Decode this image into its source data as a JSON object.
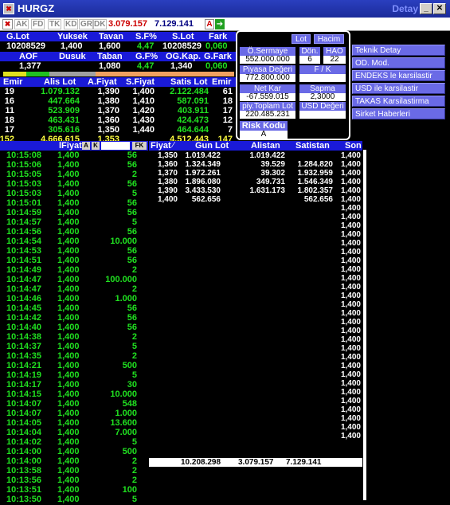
{
  "window": {
    "symbol": "HURGZ",
    "detail_label": "Detay"
  },
  "toolbar": {
    "buttons": [
      "AK",
      "FD",
      "TK",
      "KD",
      "GR",
      "DK"
    ],
    "price_value": "3.079.157",
    "volume_value": "7.129.141",
    "a_label": "A"
  },
  "summary": {
    "headers1": [
      "G.Lot",
      "Yuksek",
      "Tavan",
      "S.F%",
      "S.Lot",
      "Fark"
    ],
    "values1": [
      "10208529",
      "1,400",
      "1,600",
      "4,47",
      "10208529",
      "0,060"
    ],
    "headers2": [
      "AOF",
      "Dusuk",
      "Taban",
      "G.F%",
      "OG.Kap.",
      "G.Fark"
    ],
    "values2": [
      "1,377",
      "",
      "1,080",
      "4,47",
      "1,340",
      "0,060"
    ]
  },
  "depth": {
    "headers": [
      "Emir",
      "Alis Lot",
      "A.Fiyat",
      "S.Fiyat",
      "Satis Lot",
      "Emir"
    ],
    "rows": [
      [
        "19",
        "1.079.132",
        "1,390",
        "1,400",
        "2.122.484",
        "61"
      ],
      [
        "16",
        "447.664",
        "1,380",
        "1,410",
        "587.091",
        "18"
      ],
      [
        "11",
        "523.909",
        "1,370",
        "1,420",
        "403.911",
        "17"
      ],
      [
        "18",
        "463.431",
        "1,360",
        "1,430",
        "424.473",
        "12"
      ],
      [
        "17",
        "305.616",
        "1,350",
        "1,440",
        "464.644",
        "7"
      ]
    ],
    "totals": [
      "152",
      "4.666.615",
      "1,353",
      "",
      "4.512.443",
      "147"
    ]
  },
  "popup": {
    "lot_btn": "Lot",
    "hacim_btn": "Hacim",
    "osermaye_label": "Ö.Sermaye",
    "osermaye_value": "552.000.000",
    "don_label": "Dön.",
    "don_value": "6",
    "hao_label": "HAO",
    "hao_value": "22",
    "piyasa_label": "Piyasa Değeri",
    "piyasa_value": "772.800.000",
    "fk_label": "F / K",
    "fk_value": "",
    "netkar_label": "Net Kar",
    "netkar_value": "-67.559.015",
    "sapma_label": "Sapma",
    "sapma_value": "2,3000",
    "piytop_label": "piy.Toplam Lot",
    "piytop_value": "220.485.231",
    "usd_label": "USD Değeri",
    "usd_value": "",
    "risk_label": "Risk Kodu",
    "risk_value": "A"
  },
  "side_menu": [
    "Teknik Detay",
    "OD. Mod.",
    "ENDEKS le karsilastir",
    "USD ile karsilastir",
    "TAKAS Karsilastirma",
    "Sirket Haberleri"
  ],
  "trades": {
    "headers": [
      "",
      "lFiyat",
      "",
      ""
    ],
    "filter_a": "A",
    "filter_k": "K",
    "fk_label": "FK",
    "rows": [
      [
        "10:15:08",
        "1,400",
        "56"
      ],
      [
        "10:15:06",
        "1,400",
        "56"
      ],
      [
        "10:15:05",
        "1,400",
        "2"
      ],
      [
        "10:15:03",
        "1,400",
        "56"
      ],
      [
        "10:15:03",
        "1,400",
        "5"
      ],
      [
        "10:15:01",
        "1,400",
        "56"
      ],
      [
        "10:14:59",
        "1,400",
        "56"
      ],
      [
        "10:14:57",
        "1,400",
        "5"
      ],
      [
        "10:14:56",
        "1,400",
        "56"
      ],
      [
        "10:14:54",
        "1,400",
        "10.000"
      ],
      [
        "10:14:53",
        "1,400",
        "56"
      ],
      [
        "10:14:51",
        "1,400",
        "56"
      ],
      [
        "10:14:49",
        "1,400",
        "2"
      ],
      [
        "10:14:47",
        "1,400",
        "100.000"
      ],
      [
        "10:14:47",
        "1,400",
        "2"
      ],
      [
        "10:14:46",
        "1,400",
        "1.000"
      ],
      [
        "10:14:45",
        "1,400",
        "56"
      ],
      [
        "10:14:42",
        "1,400",
        "56"
      ],
      [
        "10:14:40",
        "1,400",
        "56"
      ],
      [
        "10:14:38",
        "1,400",
        "2"
      ],
      [
        "10:14:37",
        "1,400",
        "5"
      ],
      [
        "10:14:35",
        "1,400",
        "2"
      ],
      [
        "10:14:21",
        "1,400",
        "500"
      ],
      [
        "10:14:19",
        "1,400",
        "5"
      ],
      [
        "10:14:17",
        "1,400",
        "30"
      ],
      [
        "10:14:15",
        "1,400",
        "10.000"
      ],
      [
        "10:14:07",
        "1,400",
        "548"
      ],
      [
        "10:14:07",
        "1,400",
        "1.000"
      ],
      [
        "10:14:05",
        "1,400",
        "13.600"
      ],
      [
        "10:14:04",
        "1,400",
        "7.000"
      ],
      [
        "10:14:02",
        "1,400",
        "5"
      ],
      [
        "10:14:00",
        "1,400",
        "500"
      ],
      [
        "10:14:00",
        "1,400",
        "2"
      ],
      [
        "10:13:58",
        "1,400",
        "2"
      ],
      [
        "10:13:56",
        "1,400",
        "2"
      ],
      [
        "10:13:51",
        "1,400",
        "100"
      ],
      [
        "10:13:50",
        "1,400",
        "5"
      ]
    ]
  },
  "pricebook": {
    "headers": [
      "Fiyat",
      "Gun Lot",
      "Alistan",
      "Satistan",
      "Son"
    ],
    "rows": [
      [
        "1,350",
        "1.019.422",
        "1.019.422",
        "",
        ""
      ],
      [
        "1,360",
        "1.324.349",
        "39.529",
        "1.284.820",
        ""
      ],
      [
        "1,370",
        "1.972.261",
        "39.302",
        "1.932.959",
        ""
      ],
      [
        "1,380",
        "1.896.080",
        "349.731",
        "1.546.349",
        ""
      ],
      [
        "1,390",
        "3.433.530",
        "1.631.173",
        "1.802.357",
        ""
      ],
      [
        "1,400",
        "562.656",
        "",
        "562.656",
        ""
      ]
    ],
    "son_values": [
      "1,400",
      "1,400",
      "1,400",
      "1,400",
      "1,400",
      "1,400",
      "1,400",
      "1,400",
      "1,400",
      "1,400",
      "1,400",
      "1,400",
      "1,400",
      "1,400",
      "1,400",
      "1,400",
      "1,400",
      "1,400",
      "1,400",
      "1,400",
      "1,400",
      "1,400",
      "1,400",
      "1,400",
      "1,400",
      "1,400",
      "1,400",
      "1,400",
      "1,400",
      "1,400",
      "1,400",
      "1,400",
      "1,400"
    ],
    "totals": [
      "10.208.298",
      "3.079.157",
      "7.129.141"
    ]
  }
}
